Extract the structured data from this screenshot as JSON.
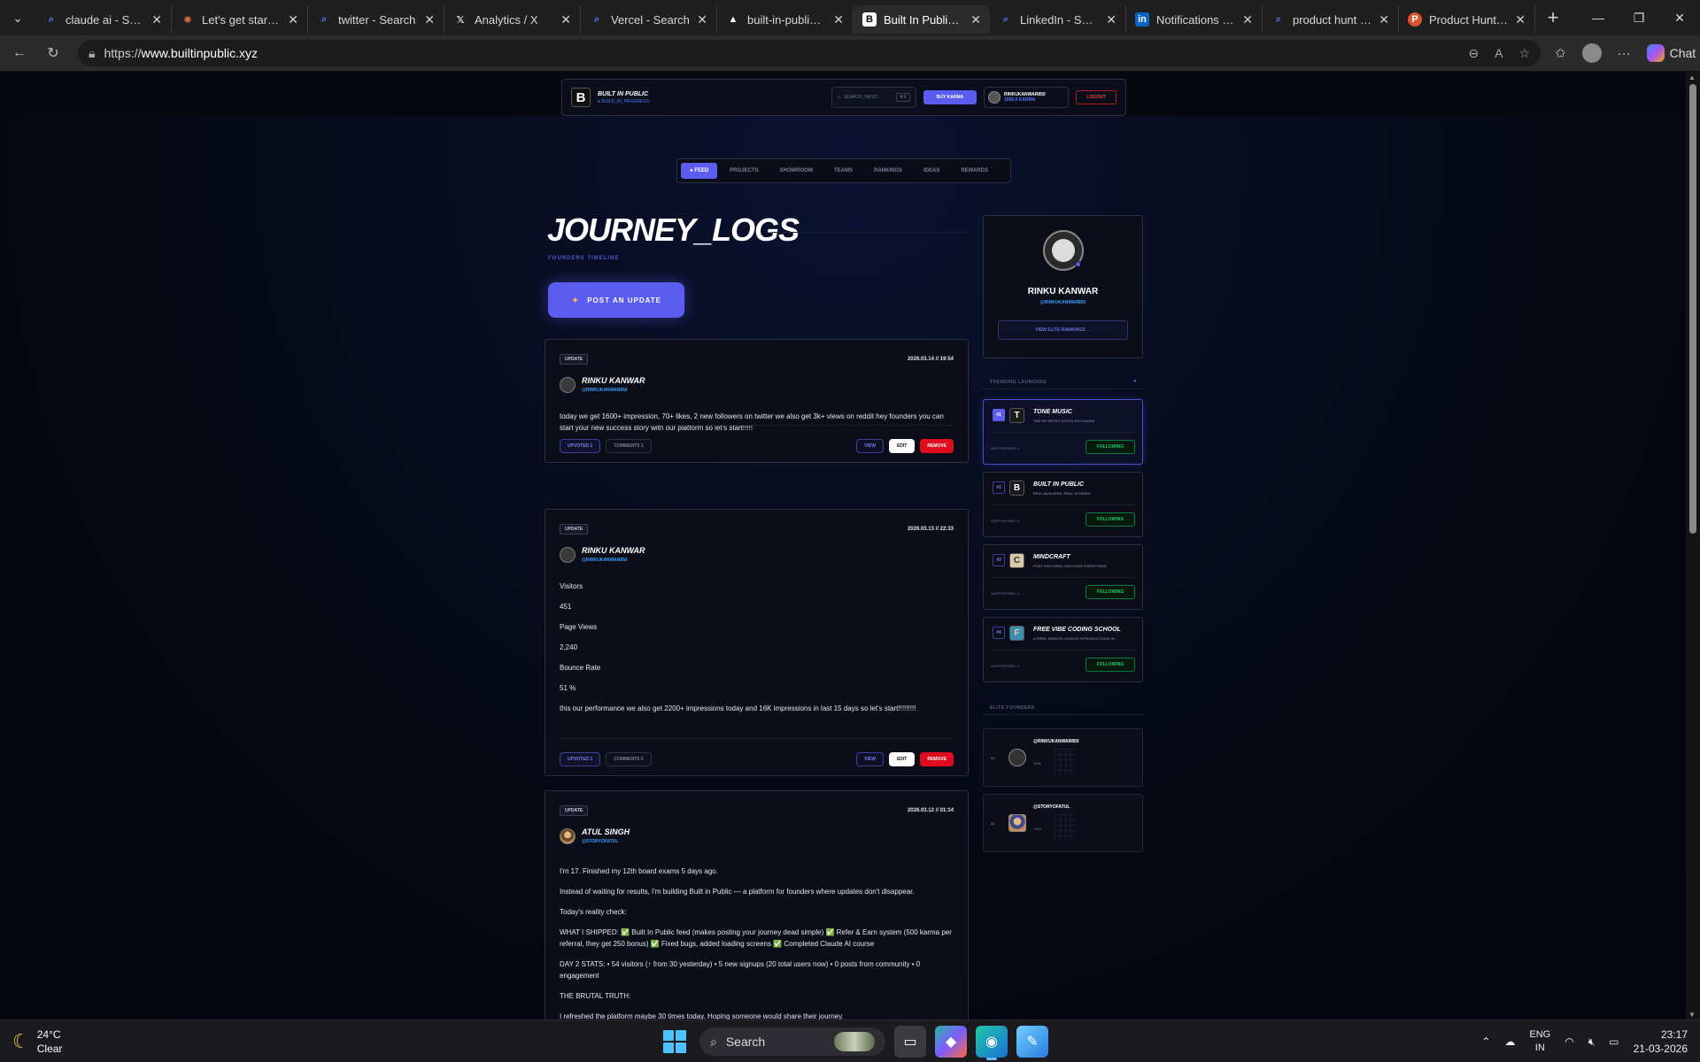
{
  "browser": {
    "tabs": [
      {
        "title": "claude ai - Search",
        "fav": "search-icon",
        "color": "#4f7bff"
      },
      {
        "title": "Let's get started -",
        "fav": "claude-spark-icon",
        "color": "#e26b4a"
      },
      {
        "title": "twitter - Search",
        "fav": "search-icon",
        "color": "#4f7bff"
      },
      {
        "title": "Analytics / X",
        "fav": "x-logo-icon",
        "color": "#ffffff"
      },
      {
        "title": "Vercel - Search",
        "fav": "search-icon",
        "color": "#4f7bff"
      },
      {
        "title": "built-in-public – A",
        "fav": "vercel-triangle-icon",
        "color": "#ffffff"
      },
      {
        "title": "Built In Public - Re",
        "fav": "builtinpublic-logo-icon",
        "color": "#ffffff",
        "active": true
      },
      {
        "title": "LinkedIn - Search",
        "fav": "search-icon",
        "color": "#4f7bff"
      },
      {
        "title": "Notifications | Lin",
        "fav": "linkedin-logo-icon",
        "color": "#0a66c2"
      },
      {
        "title": "product hunt - Se",
        "fav": "search-icon",
        "color": "#4f7bff"
      },
      {
        "title": "Product Hunt – Th",
        "fav": "producthunt-logo-icon",
        "color": "#da552f"
      }
    ],
    "url_prefix": "https://",
    "url_host": "www.builtinpublic.xyz",
    "chat_label": "Chat"
  },
  "site": {
    "brand_name": "BUILT IN PUBLIC",
    "brand_tag": "● BUILD_IN_PROGRESS",
    "search_placeholder": "SEARCH_INPUT...",
    "search_kbd": "⌘K",
    "buy_karma": "BUY KARMA",
    "user_handle": "RINKUKANWAR850",
    "user_karma": "1056.0 KARMA",
    "logout": "LOGOUT",
    "nav": [
      "● FEED",
      "PROJECTS",
      "SHOWROOM",
      "TEAMS",
      "RANKINGS",
      "IDEAS",
      "REWARDS"
    ]
  },
  "feed": {
    "title": "JOURNEY_LOGS",
    "subtitle": "FOUNDERS TIMELINE",
    "post_button": "POST AN UPDATE",
    "posts": [
      {
        "tag": "UPDATE",
        "date": "2026.03.14 // 19:54",
        "author": "RINKU KANWAR",
        "handle": "@RINKUKANWAR850",
        "body": [
          "today we get 1600+ impression, 70+ likes, 2 new followers on twitter we also get 3k+ views on reddit hey founders you can start your new success story with our platform so let's start!!!!!"
        ],
        "upvoted": "UPVOTED 1",
        "comments": "COMMENTS 1",
        "view": "VIEW",
        "edit": "EDIT",
        "remove": "REMOVE"
      },
      {
        "tag": "UPDATE",
        "date": "2026.03.13 // 22:33",
        "author": "RINKU KANWAR",
        "handle": "@RINKUKANWAR850",
        "body": [
          "Visitors",
          "451",
          "Page Views",
          "2,240",
          "Bounce Rate",
          "51 %",
          "this our performance we also get 2200+ impressions today and 16K impressions in last 15 days so let's start!!!!!!!!!"
        ],
        "upvoted": "UPVOTED 2",
        "comments": "COMMENTS 0",
        "view": "VIEW",
        "edit": "EDIT",
        "remove": "REMOVE"
      },
      {
        "tag": "UPDATE",
        "date": "2026.03.12 // 01:14",
        "author": "ATUL SINGH",
        "handle": "@STORYOFATUL",
        "body": [
          "I'm 17. Finished my 12th board exams 5 days ago.",
          "Instead of waiting for results, I'm building Built in Public — a platform for founders where updates don't disappear.",
          "Today's reality check:",
          "WHAT I SHIPPED: ✅ Built In Public feed (makes posting your journey dead simple) ✅ Refer & Earn system (500 karma per referral, they get 250 bonus) ✅ Fixed bugs, added loading screens ✅ Completed Claude AI course",
          "DAY 2 STATS: • 54 visitors (↑ from 30 yesterday) • 5 new signups (20 total users now) • 0 posts from community • 0 engagement",
          "THE BRUTAL TRUTH:",
          "I refreshed the platform maybe 30 times today. Hoping someone would share their journey."
        ]
      }
    ]
  },
  "sidebar": {
    "profile_name": "RINKU KANWAR",
    "profile_handle": "@RINKUKANWAR850",
    "profile_button": "VIEW ELITE RANKINGS →",
    "trending_label": "TRENDING LAUNCHES",
    "launches": [
      {
        "rank": "#1",
        "icon": "T",
        "name": "TONE MUSIC",
        "desc": "THE MP ARTIST STOCK EXCHANGE",
        "supporters": "SUPPORTERS: 4",
        "follow": "FOLLOWING"
      },
      {
        "rank": "#2",
        "icon": "B",
        "name": "BUILT IN PUBLIC",
        "desc": "REAL BUILDERS. REAL STORIES.",
        "supporters": "SUPPORTERS: 4",
        "follow": "FOLLOWING"
      },
      {
        "rank": "#3",
        "icon": "C",
        "name": "MINDCRAFT",
        "desc": "POST ANYTHING, DISCOVER EVERYTHING",
        "supporters": "SUPPORTERS: 2",
        "follow": "FOLLOWING"
      },
      {
        "rank": "#4",
        "icon": "F",
        "name": "FREE VIBE CODING SCHOOL",
        "desc": "A FREE, REMOTE SCHOOL INTRODUCTIONS IN...",
        "supporters": "SUPPORTERS: 2",
        "follow": "FOLLOWING"
      }
    ],
    "elite_label": "ELITE FOUNDERS",
    "founders": [
      {
        "rank": "01",
        "handle": "@RINKUKANWAR850",
        "karma": "1056"
      },
      {
        "rank": "02",
        "handle": "@STORYOFATUL",
        "karma": "1000"
      }
    ]
  },
  "taskbar": {
    "temp": "24°C",
    "condition": "Clear",
    "search": "Search",
    "lang1": "ENG",
    "lang2": "IN",
    "time": "23:17",
    "date": "21-03-2026"
  }
}
